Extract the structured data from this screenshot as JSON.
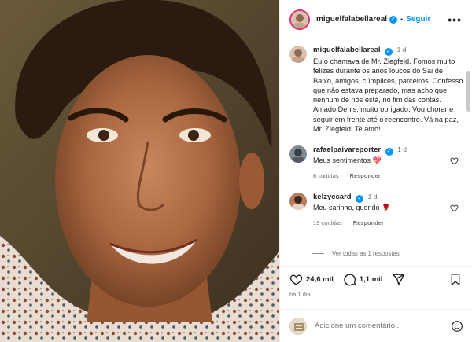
{
  "header": {
    "username": "miguelfalabellareal",
    "follow_label": "Seguir",
    "more_label": "•••"
  },
  "caption": {
    "username": "miguelfalabellareal",
    "ago": "1 d",
    "text": "Eu o chamava de Mr. Ziegfeld. Fomos muito felizes durante os anos loucos do Sai de Baixo, amigos, cúmplices, parceiros. Confesso que não estava preparado, mas acho que nenhum de nós está, no fim das contas. Amado Denis, muito obrigado. Vou chorar e seguir em frente até o reencontro. Vá na paz, Mr. Ziegfeld! Te amo!"
  },
  "comments": [
    {
      "username": "rafaelpaivareporter",
      "ago": "1 d",
      "text": "Meus sentimentos",
      "emoji": "💖",
      "likes": "6 curtidas",
      "reply_label": "Responder"
    },
    {
      "username": "kelzyecard",
      "ago": "1 d",
      "text": "Meu carinho, querido",
      "emoji": "🌹",
      "likes": "19 curtidas",
      "reply_label": "Responder"
    }
  ],
  "view_all_label": "Ver todas as 1 respostas",
  "actions": {
    "like_count": "24,6 mil",
    "comment_count": "1,1 mil",
    "posted_ago": "há 1 dia"
  },
  "add_comment": {
    "placeholder": "Adicione um comentário..."
  },
  "colors": {
    "accent": "#0095f6",
    "verified": "#0095f6",
    "muted": "#737373",
    "border": "#efefef"
  },
  "icons": [
    "verified-icon",
    "heart-icon",
    "comment-icon",
    "share-icon",
    "bookmark-icon",
    "emoji-icon",
    "more-icon"
  ]
}
